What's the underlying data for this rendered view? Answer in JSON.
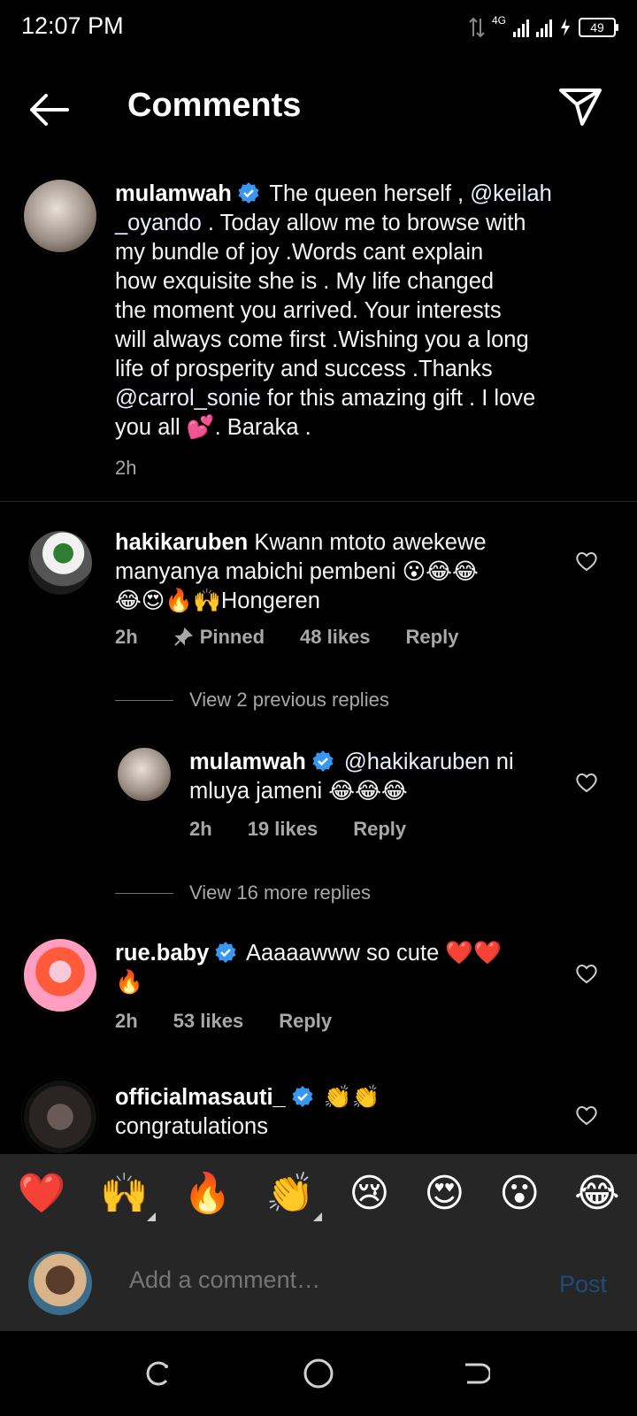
{
  "status_bar": {
    "time": "12:07 PM",
    "network": "4G",
    "battery": "49"
  },
  "header": {
    "title": "Comments",
    "back_icon": "arrow-left-icon",
    "send_icon": "paper-plane-icon"
  },
  "caption": {
    "username": "mulamwah",
    "verified": true,
    "text_part1": " The queen herself , ",
    "mention1": "@keilah",
    "line_2_mention": "_oyando",
    "text_part2": " . Today allow me to browse with",
    "text_part3": "my bundle of joy .Words cant explain",
    "text_part4": "how exquisite she is . My life changed",
    "text_part5": "the moment you arrived. Your interests",
    "text_part6": "will always come first .Wishing you a long",
    "text_part7": "life of prosperity and success .Thanks",
    "mention2": "@carrol_sonie",
    "text_part8": " for this amazing gift . I love",
    "text_part9": "you all ",
    "emoji_heart": "💕",
    "text_part10": ". Baraka .",
    "time": "2h"
  },
  "comments": [
    {
      "username": "hakikaruben",
      "line1": " Kwann mtoto awekewe",
      "line2": "manyanya mabichi pembeni 😮😂😂",
      "line3": "😂😍🔥🙌Hongeren",
      "time": "2h",
      "pinned": "Pinned",
      "likes": "48 likes",
      "reply": "Reply"
    },
    {
      "username": "mulamwah",
      "mention": " @hakikaruben",
      "line1_rest": " ni",
      "line2": "mluya jameni 😂😂😂",
      "time": "2h",
      "likes": "19 likes",
      "reply": "Reply"
    },
    {
      "username": "rue.baby",
      "line1": " Aaaaawww so cute ❤️❤️",
      "line2": "🔥",
      "time": "2h",
      "likes": "53 likes",
      "reply": "Reply"
    },
    {
      "username": "officialmasauti_",
      "line1": " 👏👏",
      "line2": "congratulations"
    }
  ],
  "view_previous": "View 2 previous replies",
  "view_more": "View 16 more replies",
  "emoji_bar": [
    "❤️",
    "🙌",
    "🔥",
    "👏",
    "😢",
    "😍",
    "😮",
    "😂"
  ],
  "composer": {
    "placeholder": "Add a comment…",
    "post": "Post"
  },
  "colors": {
    "background": "#000000",
    "verified_blue": "#3897f0",
    "muted_text": "#a8a8a8",
    "post_disabled": "#204a7a"
  }
}
